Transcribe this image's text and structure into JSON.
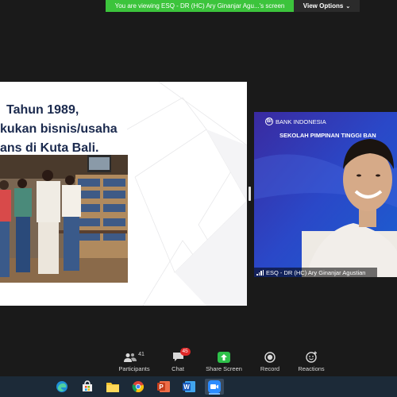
{
  "banner": {
    "viewing_text": "You are viewing ESQ - DR (HC) Ary Ginanjar Agu...'s screen",
    "view_options_label": "View Options"
  },
  "slide": {
    "lines": [
      "Tahun 1989,",
      "kukan bisnis/usaha",
      "ans di Kuta Bali."
    ]
  },
  "video": {
    "org_name": "BANK INDONESIA",
    "org_mark": "BI",
    "program_title": "SEKOLAH PIMPINAN TINGGI BAN",
    "participant_label": "ESQ - DR (HC) Ary Ginanjar Agustian"
  },
  "toolbar": {
    "participants": {
      "label": "Participants",
      "count": "41",
      "icon": "participants-icon"
    },
    "chat": {
      "label": "Chat",
      "badge": "45",
      "icon": "chat-icon"
    },
    "share_screen": {
      "label": "Share Screen",
      "icon": "share-screen-icon"
    },
    "record": {
      "label": "Record",
      "icon": "record-icon"
    },
    "reactions": {
      "label": "Reactions",
      "icon": "reactions-icon"
    }
  },
  "taskbar": {
    "apps": [
      "edge",
      "store",
      "file-explorer",
      "chrome",
      "powerpoint",
      "word",
      "zoom"
    ],
    "active_app": "zoom"
  },
  "colors": {
    "banner_green": "#3cc43c",
    "share_green": "#2ec14a",
    "badge_red": "#e02828",
    "slide_text": "#1b2a4e",
    "video_bg": "#2a3aa8"
  }
}
